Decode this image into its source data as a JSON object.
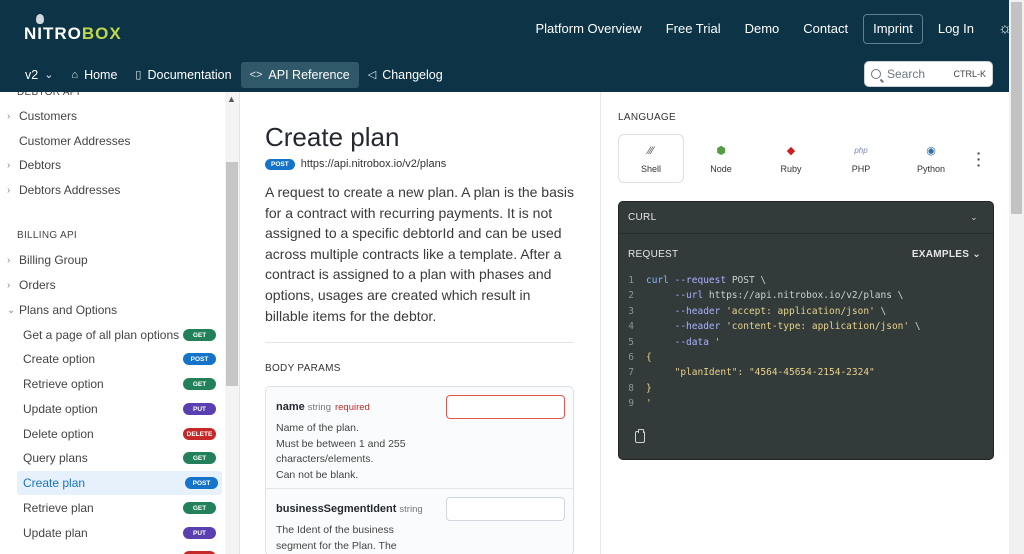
{
  "brand": {
    "logo_text_a": "NITRO",
    "logo_text_b": "BOX"
  },
  "topnav": {
    "items": [
      "Platform Overview",
      "Free Trial",
      "Demo",
      "Contact"
    ],
    "imprint": "Imprint",
    "login": "Log In",
    "theme_icon": "sun-icon"
  },
  "subnav": {
    "version": "v2",
    "home": "Home",
    "documentation": "Documentation",
    "api_reference": "API Reference",
    "changelog": "Changelog"
  },
  "search": {
    "placeholder": "Search",
    "shortcut": "CTRL-K"
  },
  "sidebar": {
    "partial_section": "DEBTOR API",
    "debtor_items": [
      "Customers",
      "Customer Addresses",
      "Debtors",
      "Debtors Addresses"
    ],
    "billing_section": "BILLING API",
    "billing_items": [
      "Billing Group",
      "Orders",
      "Plans and Options"
    ],
    "plan_items": [
      {
        "label": "Get a page of all plan options",
        "method": "GET"
      },
      {
        "label": "Create option",
        "method": "POST"
      },
      {
        "label": "Retrieve option",
        "method": "GET"
      },
      {
        "label": "Update option",
        "method": "PUT"
      },
      {
        "label": "Delete option",
        "method": "DELETE"
      },
      {
        "label": "Query plans",
        "method": "GET"
      },
      {
        "label": "Create plan",
        "method": "POST",
        "active": true
      },
      {
        "label": "Retrieve plan",
        "method": "GET"
      },
      {
        "label": "Update plan",
        "method": "PUT"
      }
    ]
  },
  "page": {
    "title": "Create plan",
    "method": "POST",
    "url": "https://api.nitrobox.io/v2/plans",
    "description": "A request to create a new plan. A plan is the basis for a contract with recurring payments. It is not assigned to a specific debtorId and can be used across multiple contracts like a template. After a contract is assigned to a plan with phases and options, usages are created which result in billable items for the debtor.",
    "body_params_title": "BODY PARAMS",
    "params": [
      {
        "name": "name",
        "type": "string",
        "required": "required",
        "desc_lines": [
          "Name of the plan.",
          "Must be between 1 and 255 characters/elements.",
          "Can not be blank."
        ]
      },
      {
        "name": "businessSegmentIdent",
        "type": "string",
        "required": "",
        "desc_lines": [
          "The Ident of the business segment for the Plan. The"
        ]
      }
    ]
  },
  "right_panel": {
    "language_title": "LANGUAGE",
    "languages": [
      {
        "name": "Shell",
        "icon": "shell-icon",
        "active": true
      },
      {
        "name": "Node",
        "icon": "node-icon"
      },
      {
        "name": "Ruby",
        "icon": "ruby-icon"
      },
      {
        "name": "PHP",
        "icon": "php-icon"
      },
      {
        "name": "Python",
        "icon": "python-icon"
      }
    ],
    "code_header": "CURL",
    "request_label": "REQUEST",
    "examples_label": "EXAMPLES",
    "code_lines": [
      "curl --request POST \\",
      "     --url https://api.nitrobox.io/v2/plans \\",
      "     --header 'accept: application/json' \\",
      "     --header 'content-type: application/json' \\",
      "     --data '",
      "{",
      "     \"planIdent\": \"4564-45654-2154-2324\"",
      "}",
      "'"
    ]
  },
  "colors": {
    "header_bg": "#0c3446",
    "accent": "#c2d64a",
    "get": "#22805a",
    "post": "#1574c9",
    "put": "#5a3fb0",
    "delete": "#c62828",
    "code_bg": "#333a3a"
  }
}
